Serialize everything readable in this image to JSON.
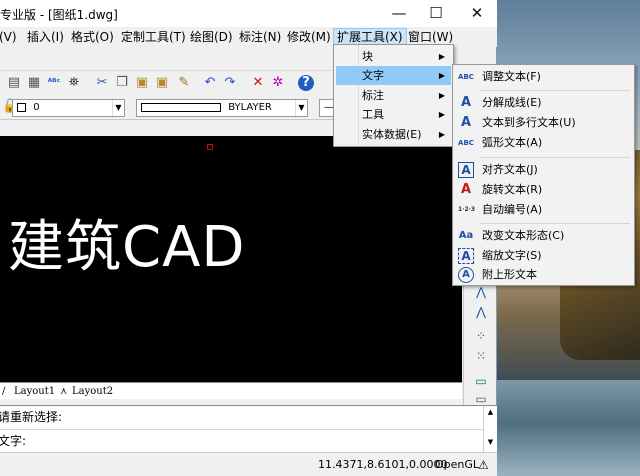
{
  "window": {
    "title": "专业版 - [图纸1.dwg]",
    "controls": {
      "minimize": "—",
      "maximize": "☐",
      "close": "✕"
    }
  },
  "menubar": {
    "items": [
      "(V)",
      "插入(I)",
      "格式(O)",
      "定制工具(T)",
      "绘图(D)",
      "标注(N)",
      "修改(M)",
      "扩展工具(X)",
      "窗口(W)"
    ]
  },
  "propbar": {
    "layer_value": "0",
    "linetype_value": "BYLAYER"
  },
  "canvas": {
    "text": "建筑CAD"
  },
  "layout_tabs": [
    "Layout1",
    "Layout2"
  ],
  "command": {
    "line1": "请重新选择:",
    "line2": "文字:"
  },
  "status": {
    "coords": "11.4371,8.6101,0.0000",
    "renderer": "OpenGL"
  },
  "dropdown": {
    "items": [
      "块",
      "文字",
      "标注",
      "工具",
      "实体数据(E)"
    ]
  },
  "submenu": {
    "items": [
      {
        "label": "调整文本(F)",
        "icon": "abc-adjust-icon"
      },
      {
        "label": "分解成线(E)",
        "icon": "explode-text-icon"
      },
      {
        "label": "文本到多行文本(U)",
        "icon": "text-to-mtext-icon"
      },
      {
        "label": "弧形文本(A)",
        "icon": "arc-text-icon"
      },
      {
        "label": "对齐文本(J)",
        "icon": "align-text-icon"
      },
      {
        "label": "旋转文本(R)",
        "icon": "rotate-text-icon"
      },
      {
        "label": "自动编号(A)",
        "icon": "auto-number-icon"
      },
      {
        "label": "改变文本形态(C)",
        "icon": "change-case-icon"
      },
      {
        "label": "缩放文字(S)",
        "icon": "scale-text-icon"
      },
      {
        "label": "附上形文本",
        "icon": "enclose-text-icon"
      }
    ]
  }
}
